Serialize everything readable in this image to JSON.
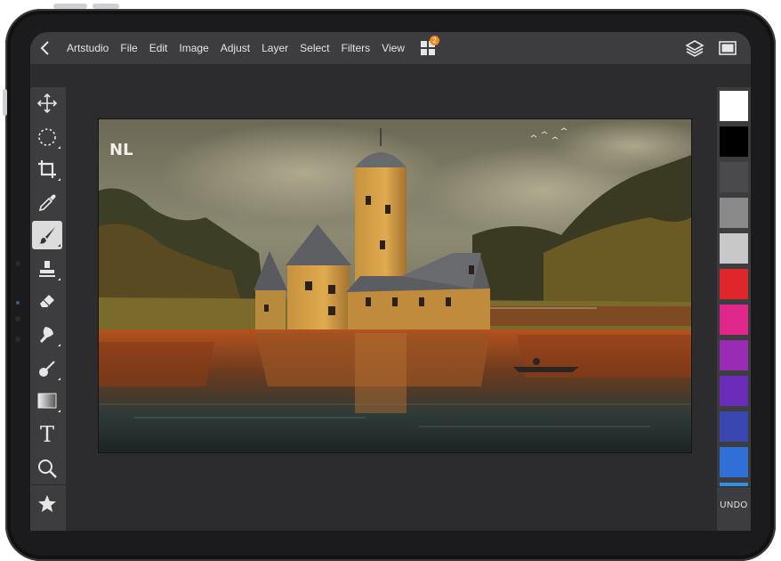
{
  "menubar": {
    "items": [
      "Artstudio",
      "File",
      "Edit",
      "Image",
      "Adjust",
      "Layer",
      "Select",
      "Filters",
      "View"
    ],
    "badge": "2",
    "icons": [
      "chevron-left-icon",
      "apps-grid-icon",
      "layers-icon",
      "fullscreen-icon"
    ]
  },
  "toolbar": {
    "tools": [
      {
        "name": "move-tool",
        "icon": "move-arrows-icon"
      },
      {
        "name": "selection-tool",
        "icon": "dotted-circle-icon"
      },
      {
        "name": "crop-tool",
        "icon": "crop-icon"
      },
      {
        "name": "eyedropper-tool",
        "icon": "eyedropper-icon"
      },
      {
        "name": "brush-tool",
        "icon": "brush-icon",
        "active": true
      },
      {
        "name": "stamp-tool",
        "icon": "stamp-icon"
      },
      {
        "name": "eraser-tool",
        "icon": "eraser-icon"
      },
      {
        "name": "smudge-tool",
        "icon": "smudge-icon"
      },
      {
        "name": "dodge-burn-tool",
        "icon": "dodge-icon"
      },
      {
        "name": "gradient-tool",
        "icon": "gradient-icon"
      },
      {
        "name": "text-tool",
        "icon": "text-icon",
        "label": "T"
      },
      {
        "name": "zoom-tool",
        "icon": "magnifier-icon"
      },
      {
        "name": "favorites-tool",
        "icon": "star-icon"
      }
    ]
  },
  "palette": {
    "colors": [
      "#ffffff",
      "#000000",
      "#4a4a4c",
      "#8a8a8a",
      "#c8c8c8",
      "#e0262a",
      "#e0268a",
      "#9a2cb4",
      "#6a2cb8",
      "#3a46b0",
      "#2f6fd6",
      "#2f8ee6"
    ],
    "undo_label": "UNDO"
  },
  "canvas": {
    "signature": "NL",
    "subject": "castle-painting"
  }
}
